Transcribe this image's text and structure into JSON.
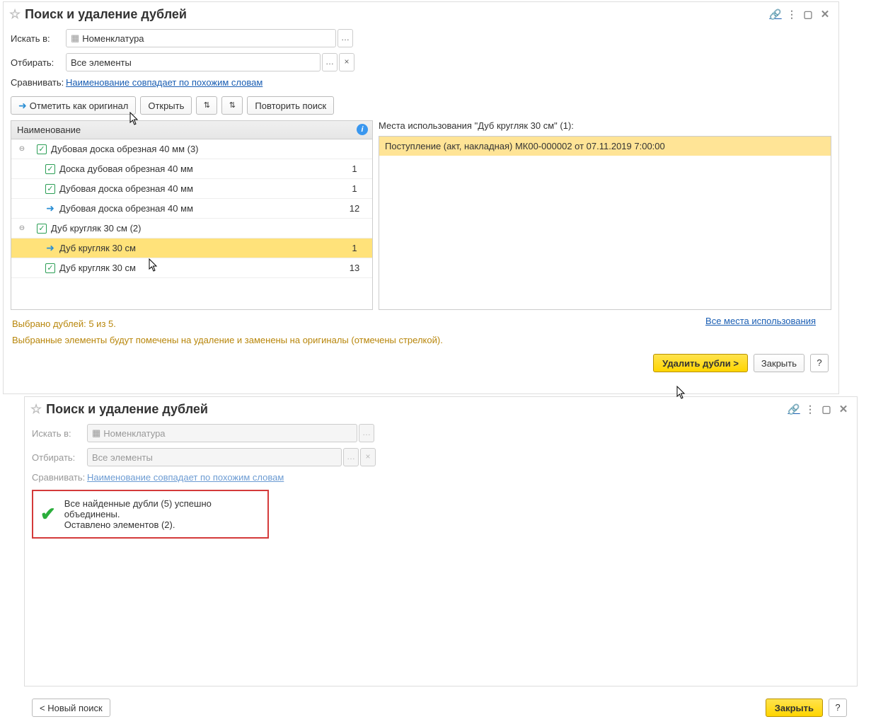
{
  "win1": {
    "title": "Поиск и удаление дублей",
    "search_in_label": "Искать в:",
    "search_in_value": "Номенклатура",
    "filter_label": "Отбирать:",
    "filter_value": "Все элементы",
    "compare_label": "Сравнивать:",
    "compare_link": "Наименование совпадает по похожим словам",
    "toolbar": {
      "mark_original": "Отметить как оригинал",
      "open": "Открыть",
      "repeat_search": "Повторить поиск"
    },
    "tree_header": "Наименование",
    "info_badge": "i",
    "rows": [
      {
        "type": "group",
        "text": "Дубовая доска обрезная 40 мм (3)",
        "checked": true
      },
      {
        "type": "item",
        "text": "Доска дубовая  обрезная 40  мм",
        "checked": true,
        "count": "1"
      },
      {
        "type": "item",
        "text": "Дубовая доска обрезная 40  мм",
        "checked": true,
        "count": "1"
      },
      {
        "type": "item-orig",
        "text": "Дубовая доска обрезная 40 мм",
        "count": "12"
      },
      {
        "type": "group",
        "text": "Дуб кругляк 30  см (2)",
        "checked": true
      },
      {
        "type": "item-orig",
        "text": "Дуб кругляк 30  см",
        "count": "1",
        "selected": true
      },
      {
        "type": "item",
        "text": "Дуб кругляк 30 см",
        "checked": true,
        "count": "13"
      }
    ],
    "usages_title": "Места использования \"Дуб кругляк 30  см\" (1):",
    "usages": [
      "Поступление (акт, накладная) МК00-000002 от 07.11.2019 7:00:00"
    ],
    "all_usages_link": "Все места использования",
    "summary1": "Выбрано дублей: 5 из 5.",
    "summary2": "Выбранные элементы будут помечены на удаление и заменены на оригиналы (отмечены стрелкой).",
    "bottom": {
      "delete": "Удалить дубли >",
      "close": "Закрыть",
      "help": "?"
    }
  },
  "win2": {
    "title": "Поиск и удаление дублей",
    "search_in_label": "Искать в:",
    "search_in_value": "Номенклатура",
    "filter_label": "Отбирать:",
    "filter_value": "Все элементы",
    "compare_label": "Сравнивать:",
    "compare_link": "Наименование совпадает по похожим словам",
    "success1": "Все найденные дубли (5) успешно объединены.",
    "success2": "Оставлено элементов (2).",
    "new_search": "< Новый поиск",
    "close": "Закрыть",
    "help": "?"
  }
}
